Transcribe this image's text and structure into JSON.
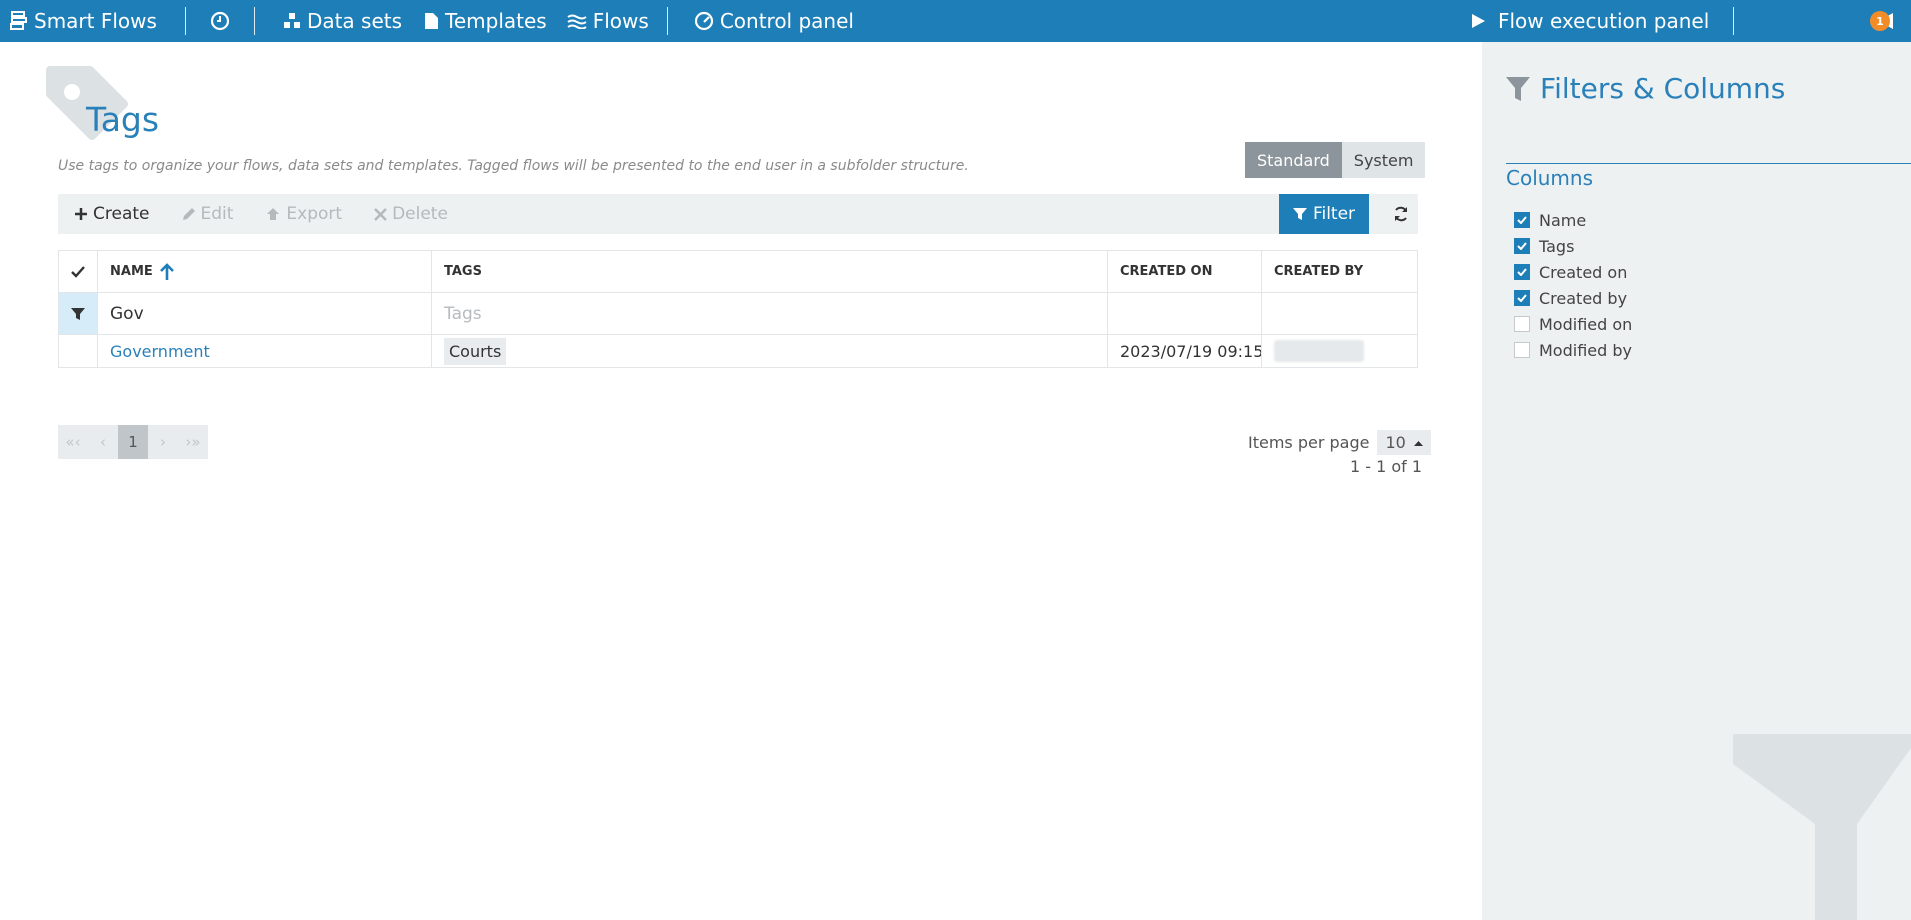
{
  "nav": {
    "brand": "Smart Flows",
    "datasets": "Data sets",
    "templates": "Templates",
    "flows": "Flows",
    "control_panel": "Control panel",
    "flow_execution": "Flow execution panel",
    "notification_count": "1"
  },
  "page": {
    "title": "Tags",
    "description": "Use tags to organize your flows, data sets and templates. Tagged flows will be presented to the end user in a subfolder structure.",
    "segment": {
      "standard": "Standard",
      "system": "System",
      "active": "Standard"
    }
  },
  "toolbar": {
    "create": "Create",
    "edit": "Edit",
    "export": "Export",
    "delete": "Delete",
    "filter": "Filter"
  },
  "grid": {
    "columns": {
      "name": "NAME",
      "tags": "TAGS",
      "created_on": "CREATED ON",
      "created_by": "CREATED BY"
    },
    "filters": {
      "name": "Gov",
      "tags_placeholder": "Tags"
    },
    "rows": [
      {
        "name": "Government",
        "tags": [
          "Courts"
        ],
        "created_on": "2023/07/19 09:15"
      }
    ]
  },
  "pager": {
    "first": "«‹",
    "prev": "‹",
    "current": "1",
    "next": "›",
    "last": "›»",
    "items_per_page_label": "Items per page",
    "items_per_page": "10",
    "range": "1 - 1 of 1"
  },
  "side": {
    "title": "Filters & Columns",
    "columns_heading": "Columns",
    "columns": [
      {
        "label": "Name",
        "checked": true
      },
      {
        "label": "Tags",
        "checked": true
      },
      {
        "label": "Created on",
        "checked": true
      },
      {
        "label": "Created by",
        "checked": true
      },
      {
        "label": "Modified on",
        "checked": false
      },
      {
        "label": "Modified by",
        "checked": false
      }
    ]
  },
  "colors": {
    "nav_bg": "#1e7fb8",
    "accent": "#2a80b9",
    "badge": "#f28c28",
    "panel_bg": "#edf1f2"
  }
}
